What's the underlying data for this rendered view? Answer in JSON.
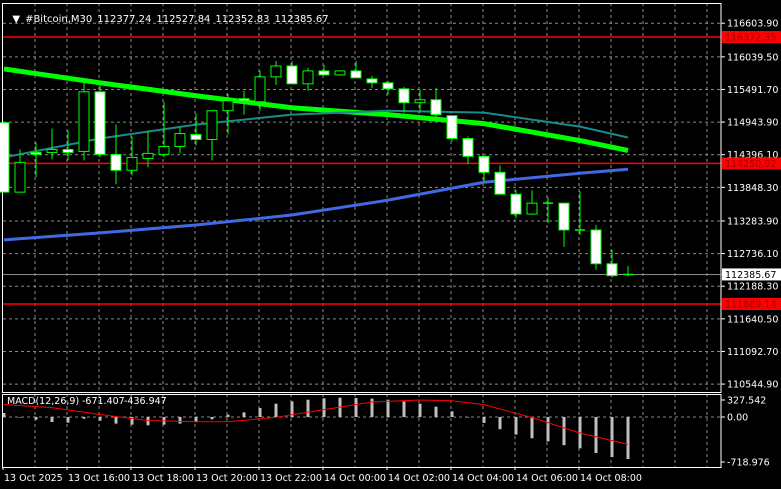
{
  "header": {
    "menu_icon": "triangle-down-icon",
    "symbol": "#Bitcoin,M30",
    "open": "112377.24",
    "high": "112527.84",
    "low": "112352.83",
    "close": "112385.67"
  },
  "colors": {
    "background": "#000000",
    "grid": "#8a8a8a",
    "bull_outline": "#00ff00",
    "bear_fill": "#ffffff",
    "ma_fast": "#00ff00",
    "ma_mid": "#1a8a8a",
    "ma_slow": "#4169e1",
    "level_line": "#ff0000",
    "macd_hist": "#c0c0c0",
    "macd_signal": "#ff0000"
  },
  "price_axis": {
    "ticks": [
      "116603.90",
      "116039.50",
      "115491.70",
      "114943.90",
      "114396.10",
      "113848.30",
      "113283.90",
      "112736.10",
      "112188.30",
      "111640.50",
      "111092.70",
      "110544.90"
    ],
    "current_price": "112385.67",
    "levels": [
      "116372.35",
      "114250.92",
      "111889.14"
    ]
  },
  "time_axis": {
    "labels": [
      "13 Oct 2025",
      "13 Oct 16:00",
      "13 Oct 18:00",
      "13 Oct 20:00",
      "13 Oct 22:00",
      "14 Oct 00:00",
      "14 Oct 02:00",
      "14 Oct 04:00",
      "14 Oct 06:00",
      "14 Oct 08:00"
    ]
  },
  "macd": {
    "title": "MACD(12,26,9)",
    "main_value": "-671.407",
    "signal_value": "-436.947",
    "axis_ticks": [
      "327.542",
      "0.00",
      "-718.976"
    ]
  },
  "chart_data": {
    "type": "candlestick",
    "symbol": "#Bitcoin",
    "timeframe": "M30",
    "ylim": [
      110544.9,
      116603.9
    ],
    "candles": [
      [
        114935,
        114935,
        113767,
        113767
      ],
      [
        113767,
        114484,
        113767,
        114267
      ],
      [
        114434,
        114601,
        114017,
        114401
      ],
      [
        114434,
        114835,
        114317,
        114484
      ],
      [
        114484,
        114801,
        114301,
        114434
      ],
      [
        114451,
        115636,
        114301,
        115452
      ],
      [
        115452,
        115636,
        114351,
        114401
      ],
      [
        114401,
        114902,
        113900,
        114134
      ],
      [
        114134,
        114701,
        114050,
        114351
      ],
      [
        114334,
        114801,
        114184,
        114418
      ],
      [
        114401,
        115285,
        114351,
        114534
      ],
      [
        114534,
        114852,
        114418,
        114751
      ],
      [
        114735,
        115085,
        114551,
        114651
      ],
      [
        114651,
        115135,
        114301,
        115135
      ],
      [
        115135,
        115419,
        114735,
        115302
      ],
      [
        115336,
        115469,
        115069,
        115302
      ],
      [
        115285,
        115803,
        115135,
        115703
      ],
      [
        115703,
        115970,
        115569,
        115886
      ],
      [
        115886,
        115970,
        115586,
        115586
      ],
      [
        115586,
        115853,
        115469,
        115803
      ],
      [
        115803,
        115903,
        115736,
        115736
      ],
      [
        115736,
        115820,
        115720,
        115803
      ],
      [
        115803,
        115970,
        115686,
        115686
      ],
      [
        115669,
        115719,
        115519,
        115603
      ],
      [
        115603,
        115636,
        115402,
        115502
      ],
      [
        115502,
        115536,
        115102,
        115269
      ],
      [
        115269,
        115486,
        115102,
        115319
      ],
      [
        115319,
        115519,
        114985,
        115069
      ],
      [
        115052,
        115052,
        114618,
        114668
      ],
      [
        114668,
        114701,
        114234,
        114368
      ],
      [
        114368,
        114368,
        113934,
        114100
      ],
      [
        114100,
        114217,
        113733,
        113733
      ],
      [
        113733,
        113800,
        113333,
        113400
      ],
      [
        113400,
        113800,
        113383,
        113583
      ],
      [
        113583,
        113683,
        113249,
        113583
      ],
      [
        113583,
        113583,
        112849,
        113132
      ],
      [
        113132,
        113783,
        113049,
        113132
      ],
      [
        113132,
        113216,
        112465,
        112565
      ],
      [
        112565,
        112799,
        112331,
        112365
      ],
      [
        112377.24,
        112527.84,
        112352.83,
        112385.67
      ]
    ],
    "moving_averages": [
      {
        "name": "ma_fast",
        "points": [
          [
            0,
            115836
          ],
          [
            6,
            115603
          ],
          [
            12,
            115386
          ],
          [
            18,
            115185
          ],
          [
            24,
            115069
          ],
          [
            30,
            114918
          ],
          [
            36,
            114634
          ],
          [
            39,
            114467
          ]
        ]
      },
      {
        "name": "ma_mid",
        "points": [
          [
            0,
            114351
          ],
          [
            6,
            114668
          ],
          [
            12,
            114902
          ],
          [
            18,
            115069
          ],
          [
            24,
            115135
          ],
          [
            30,
            115102
          ],
          [
            36,
            114868
          ],
          [
            39,
            114685
          ]
        ]
      },
      {
        "name": "ma_slow",
        "points": [
          [
            0,
            112966
          ],
          [
            6,
            113083
          ],
          [
            12,
            113216
          ],
          [
            18,
            113383
          ],
          [
            24,
            113633
          ],
          [
            30,
            113934
          ],
          [
            36,
            114084
          ],
          [
            39,
            114151
          ]
        ]
      }
    ],
    "macd_histogram": [
      64,
      0,
      -43,
      -80,
      -90,
      -27,
      -59,
      -106,
      -122,
      -133,
      -122,
      -106,
      -80,
      -37,
      37,
      74,
      144,
      213,
      250,
      277,
      298,
      309,
      303,
      293,
      277,
      250,
      213,
      165,
      90,
      0,
      -95,
      -195,
      -280,
      -340,
      -390,
      -450,
      -500,
      -575,
      -640,
      -671.407
    ],
    "macd_signal": [
      [
        0,
        200
      ],
      [
        3,
        150
      ],
      [
        6,
        40
      ],
      [
        9,
        -55
      ],
      [
        12,
        -75
      ],
      [
        14,
        -75
      ],
      [
        17,
        -5
      ],
      [
        20,
        117
      ],
      [
        23,
        240
      ],
      [
        26,
        271
      ],
      [
        28,
        260
      ],
      [
        30,
        197
      ],
      [
        33,
        -10
      ],
      [
        36,
        -255
      ],
      [
        39,
        -436.947
      ]
    ],
    "macd_ylim": [
      -718.976,
      327.542
    ]
  }
}
